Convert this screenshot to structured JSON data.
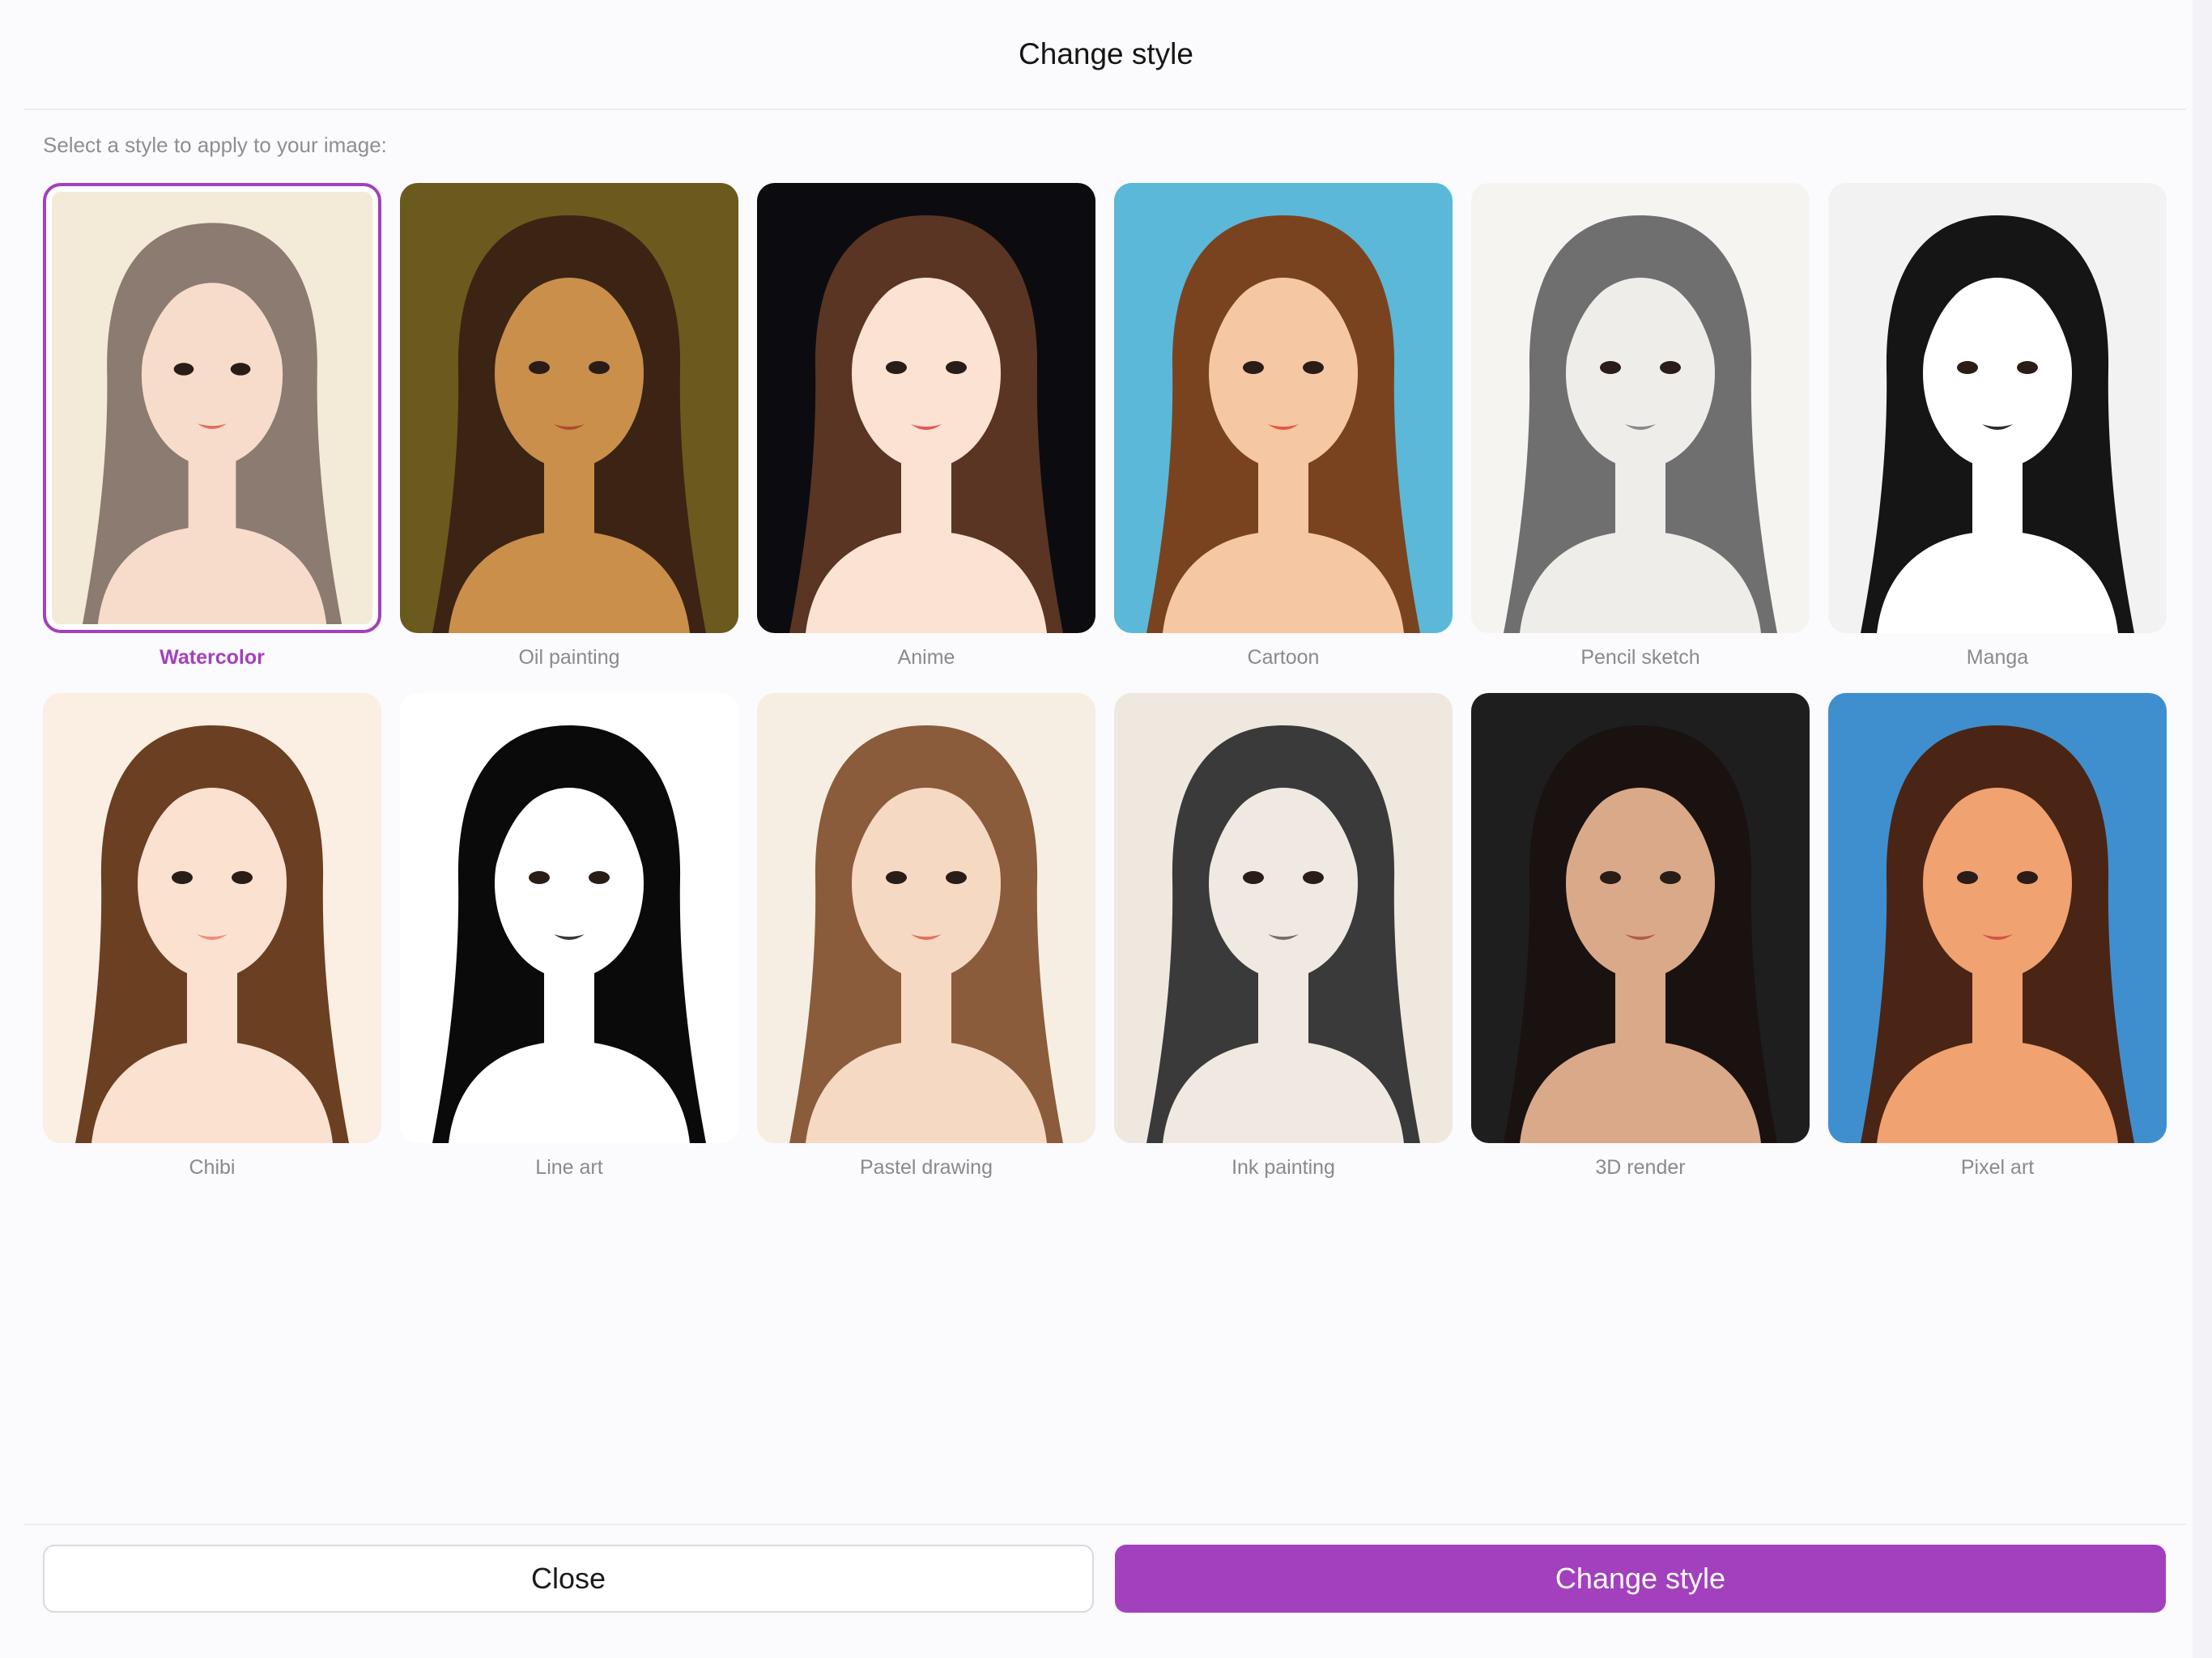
{
  "dialog": {
    "title": "Change style",
    "prompt": "Select a style to apply to your image:"
  },
  "styles": [
    {
      "label": "Watercolor",
      "selected": true,
      "bg": "#f3ead8",
      "hair": "#8c7b70",
      "skin": "#f7dccb",
      "accent": "#e06d5e"
    },
    {
      "label": "Oil painting",
      "selected": false,
      "bg": "#6b5a1d",
      "hair": "#3b2414",
      "skin": "#c98f4b",
      "accent": "#b04a2f"
    },
    {
      "label": "Anime",
      "selected": false,
      "bg": "#0c0c10",
      "hair": "#5a3524",
      "skin": "#fbe2d3",
      "accent": "#e25757"
    },
    {
      "label": "Cartoon",
      "selected": false,
      "bg": "#5bb8d8",
      "hair": "#7a4320",
      "skin": "#f6c7a3",
      "accent": "#e0583f"
    },
    {
      "label": "Pencil sketch",
      "selected": false,
      "bg": "#f6f4f1",
      "hair": "#6f6f6f",
      "skin": "#efedea",
      "accent": "#8a8a8a"
    },
    {
      "label": "Manga",
      "selected": false,
      "bg": "#f2f2f2",
      "hair": "#151515",
      "skin": "#ffffff",
      "accent": "#2c2c2c"
    },
    {
      "label": "Chibi",
      "selected": false,
      "bg": "#fbeee3",
      "hair": "#6b3f22",
      "skin": "#fbe1cf",
      "accent": "#f08e7d"
    },
    {
      "label": "Line art",
      "selected": false,
      "bg": "#ffffff",
      "hair": "#0a0a0a",
      "skin": "#ffffff",
      "accent": "#3a3a3a"
    },
    {
      "label": "Pastel drawing",
      "selected": false,
      "bg": "#f6eee2",
      "hair": "#8a5c3b",
      "skin": "#f6d9c3",
      "accent": "#e2725d"
    },
    {
      "label": "Ink painting",
      "selected": false,
      "bg": "#efe8de",
      "hair": "#3a3a3a",
      "skin": "#efe9e2",
      "accent": "#7a6c6a"
    },
    {
      "label": "3D render",
      "selected": false,
      "bg": "#1e1e1e",
      "hair": "#1a1210",
      "skin": "#d9a98a",
      "accent": "#b05a4f"
    },
    {
      "label": "Pixel art",
      "selected": false,
      "bg": "#3f8fcf",
      "hair": "#4a2515",
      "skin": "#f0a271",
      "accent": "#d0554a"
    }
  ],
  "footer": {
    "close_label": "Close",
    "apply_label": "Change style"
  },
  "colors": {
    "accent": "#a340bd",
    "background": "#fbfafd"
  }
}
